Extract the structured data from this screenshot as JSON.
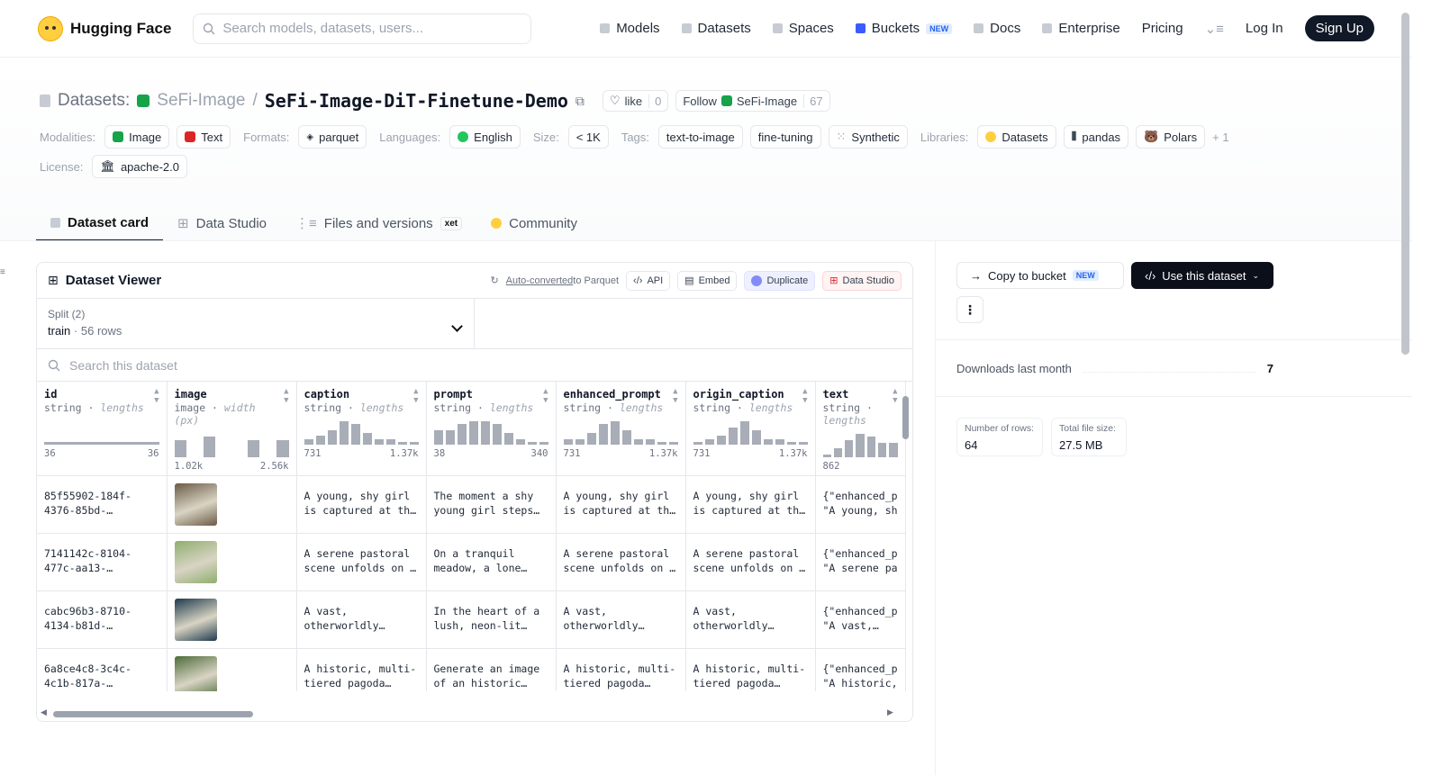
{
  "header": {
    "brand": "Hugging Face",
    "search_placeholder": "Search models, datasets, users...",
    "nav": [
      {
        "label": "Models"
      },
      {
        "label": "Datasets"
      },
      {
        "label": "Spaces"
      },
      {
        "label": "Buckets",
        "badge": "NEW"
      },
      {
        "label": "Docs"
      },
      {
        "label": "Enterprise"
      },
      {
        "label": "Pricing"
      }
    ],
    "login": "Log In",
    "signup": "Sign Up"
  },
  "repo": {
    "type_label": "Datasets:",
    "org": "SeFi-Image",
    "sep": "/",
    "name": "SeFi-Image-DiT-Finetune-Demo",
    "like_label": "like",
    "like_count": "0",
    "follow_label": "Follow",
    "follow_org": "SeFi-Image",
    "follow_count": "67"
  },
  "meta": {
    "modalities_key": "Modalities:",
    "modalities": [
      "Image",
      "Text"
    ],
    "formats_key": "Formats:",
    "formats": [
      "parquet"
    ],
    "languages_key": "Languages:",
    "languages": [
      "English"
    ],
    "size_key": "Size:",
    "size": "< 1K",
    "tags_key": "Tags:",
    "tags": [
      "text-to-image",
      "fine-tuning",
      "Synthetic"
    ],
    "libraries_key": "Libraries:",
    "libraries": [
      "Datasets",
      "pandas",
      "Polars"
    ],
    "libraries_more": "+ 1",
    "license_key": "License:",
    "license": "apache-2.0"
  },
  "tabs": [
    {
      "label": "Dataset card"
    },
    {
      "label": "Data Studio"
    },
    {
      "label": "Files and versions",
      "badge": "xet"
    },
    {
      "label": "Community"
    }
  ],
  "viewer": {
    "title": "Dataset Viewer",
    "auto_converted": "Auto-converted",
    "to_parquet": " to Parquet",
    "api": "API",
    "embed": "Embed",
    "duplicate": "Duplicate",
    "data_studio": "Data Studio",
    "split_label": "Split (2)",
    "split_value": "train",
    "split_rows": "56 rows",
    "search_placeholder": "Search this dataset",
    "columns": [
      {
        "name": "id",
        "type": "string",
        "stat": "lengths",
        "min": "36",
        "max": "36"
      },
      {
        "name": "image",
        "type": "image",
        "stat": "width (px)",
        "min": "1.02k",
        "max": "2.56k"
      },
      {
        "name": "caption",
        "type": "string",
        "stat": "lengths",
        "min": "731",
        "max": "1.37k"
      },
      {
        "name": "prompt",
        "type": "string",
        "stat": "lengths",
        "min": "38",
        "max": "340"
      },
      {
        "name": "enhanced_prompt",
        "type": "string",
        "stat": "lengths",
        "min": "731",
        "max": "1.37k"
      },
      {
        "name": "origin_caption",
        "type": "string",
        "stat": "lengths",
        "min": "731",
        "max": "1.37k"
      },
      {
        "name": "text",
        "type": "string",
        "stat": "lengths",
        "min": "862",
        "max": ""
      }
    ],
    "rows": [
      {
        "id": "85f55902-184f-4376-85bd-…",
        "caption": "A young, shy girl is captured at th…",
        "prompt": "The moment a shy young girl steps…",
        "enhanced_prompt": "A young, shy girl is captured at th…",
        "origin_caption": "A young, shy girl is captured at th…",
        "text": "{\"enhanced_p \"A young, sh",
        "thumb": "#6b5a46"
      },
      {
        "id": "7141142c-8104-477c-aa13-…",
        "caption": "A serene pastoral scene unfolds on …",
        "prompt": "On a tranquil meadow, a lone…",
        "enhanced_prompt": "A serene pastoral scene unfolds on …",
        "origin_caption": "A serene pastoral scene unfolds on …",
        "text": "{\"enhanced_p \"A serene pa",
        "thumb": "#8fae6e"
      },
      {
        "id": "cabc96b3-8710-4134-b81d-…",
        "caption": "A vast, otherworldly…",
        "prompt": "In the heart of a lush, neon-lit…",
        "enhanced_prompt": "A vast, otherworldly…",
        "origin_caption": "A vast, otherworldly…",
        "text": "{\"enhanced_p \"A vast,…",
        "thumb": "#1f3b4d"
      },
      {
        "id": "6a8ce4c8-3c4c-4c1b-817a-…",
        "caption": "A historic, multi-tiered pagoda…",
        "prompt": "Generate an image of an historic…",
        "enhanced_prompt": "A historic, multi-tiered pagoda…",
        "origin_caption": "A historic, multi-tiered pagoda…",
        "text": "{\"enhanced_p \"A historic,",
        "thumb": "#4d6b3a"
      }
    ]
  },
  "sidebar": {
    "copy_bucket": "Copy to bucket",
    "copy_badge": "NEW",
    "use_dataset": "Use this dataset",
    "downloads_label": "Downloads last month",
    "downloads_value": "7",
    "rows_label": "Number of rows:",
    "rows_value": "64",
    "size_label": "Total file size:",
    "size_value": "27.5 MB"
  }
}
